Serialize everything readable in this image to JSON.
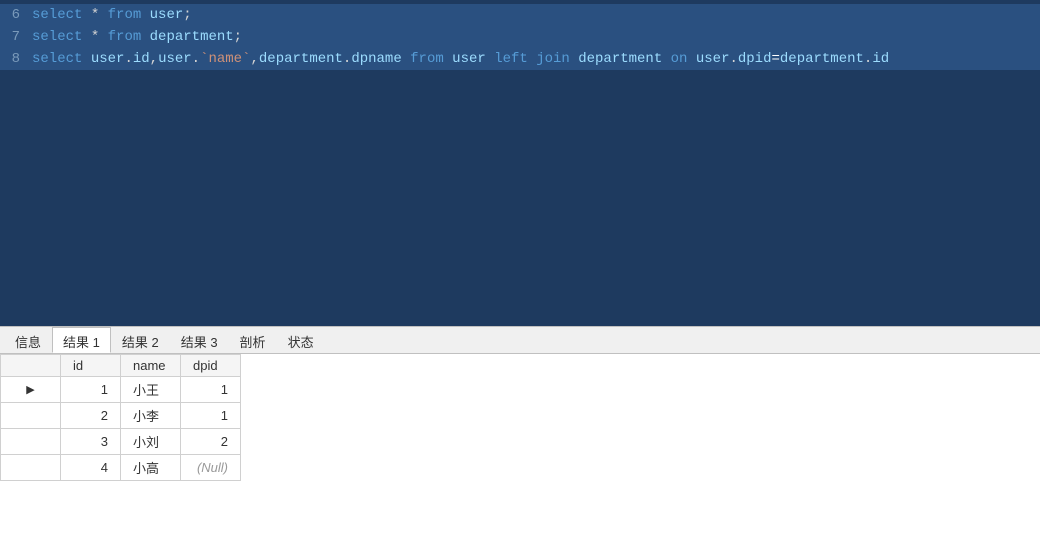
{
  "editor": {
    "lines": [
      {
        "number": "6",
        "selected": true,
        "tokens": [
          {
            "type": "kw",
            "text": "select"
          },
          {
            "type": "plain",
            "text": " * "
          },
          {
            "type": "kw",
            "text": "from"
          },
          {
            "type": "plain",
            "text": " "
          },
          {
            "type": "tb",
            "text": "user"
          },
          {
            "type": "punc",
            "text": ";"
          }
        ]
      },
      {
        "number": "7",
        "selected": true,
        "tokens": [
          {
            "type": "kw",
            "text": "select"
          },
          {
            "type": "plain",
            "text": " * "
          },
          {
            "type": "kw",
            "text": "from"
          },
          {
            "type": "plain",
            "text": " "
          },
          {
            "type": "tb",
            "text": "department"
          },
          {
            "type": "punc",
            "text": ";"
          }
        ]
      },
      {
        "number": "8",
        "selected": true,
        "tokens": [
          {
            "type": "kw",
            "text": "select"
          },
          {
            "type": "plain",
            "text": " "
          },
          {
            "type": "tb",
            "text": "user"
          },
          {
            "type": "punc",
            "text": "."
          },
          {
            "type": "tb",
            "text": "id"
          },
          {
            "type": "punc",
            "text": ","
          },
          {
            "type": "tb",
            "text": "user"
          },
          {
            "type": "punc",
            "text": "."
          },
          {
            "type": "bt",
            "text": "`name`"
          },
          {
            "type": "punc",
            "text": ","
          },
          {
            "type": "tb",
            "text": "department"
          },
          {
            "type": "punc",
            "text": "."
          },
          {
            "type": "tb",
            "text": "dpname"
          },
          {
            "type": "plain",
            "text": " "
          },
          {
            "type": "kw",
            "text": "from"
          },
          {
            "type": "plain",
            "text": " "
          },
          {
            "type": "tb",
            "text": "user"
          },
          {
            "type": "plain",
            "text": " "
          },
          {
            "type": "kw",
            "text": "left"
          },
          {
            "type": "plain",
            "text": " "
          },
          {
            "type": "kw",
            "text": "join"
          },
          {
            "type": "plain",
            "text": " "
          },
          {
            "type": "tb",
            "text": "department"
          },
          {
            "type": "plain",
            "text": " "
          },
          {
            "type": "kw",
            "text": "on"
          },
          {
            "type": "plain",
            "text": " "
          },
          {
            "type": "tb",
            "text": "user"
          },
          {
            "type": "punc",
            "text": "."
          },
          {
            "type": "tb",
            "text": "dpid"
          },
          {
            "type": "op",
            "text": "="
          },
          {
            "type": "tb",
            "text": "department"
          },
          {
            "type": "punc",
            "text": "."
          },
          {
            "type": "tb",
            "text": "id"
          }
        ]
      }
    ]
  },
  "tabs": {
    "items": [
      {
        "label": "信息",
        "active": false
      },
      {
        "label": "结果 1",
        "active": true
      },
      {
        "label": "结果 2",
        "active": false
      },
      {
        "label": "结果 3",
        "active": false
      },
      {
        "label": "剖析",
        "active": false
      },
      {
        "label": "状态",
        "active": false
      }
    ]
  },
  "table": {
    "columns": [
      "id",
      "name",
      "dpid"
    ],
    "rows": [
      {
        "indicator": "▶",
        "id": "1",
        "name": "小王",
        "dpid": "1",
        "null": false
      },
      {
        "indicator": "",
        "id": "2",
        "name": "小李",
        "dpid": "1",
        "null": false
      },
      {
        "indicator": "",
        "id": "3",
        "name": "小刘",
        "dpid": "2",
        "null": false
      },
      {
        "indicator": "",
        "id": "4",
        "name": "小高",
        "dpid": "(Null)",
        "null": true
      }
    ]
  }
}
